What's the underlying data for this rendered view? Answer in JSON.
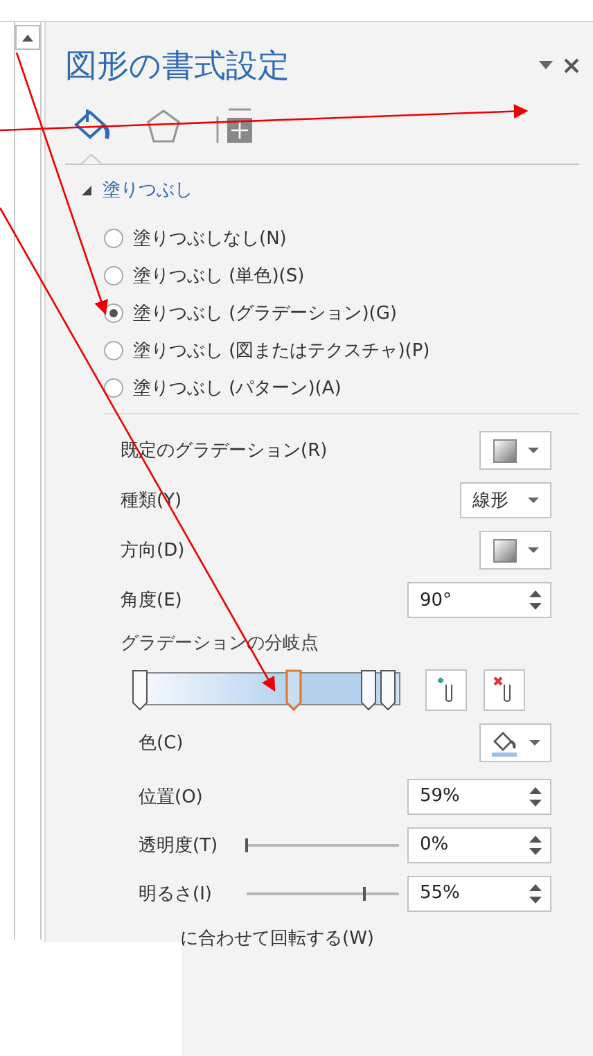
{
  "pane": {
    "title": "図形の書式設定"
  },
  "tabs": [
    {
      "kind": "fill",
      "selected": true
    },
    {
      "kind": "shape",
      "selected": false
    },
    {
      "kind": "layout",
      "selected": false
    }
  ],
  "section": {
    "title": "塗りつぶし",
    "expanded": true
  },
  "fill_options": [
    {
      "label": "塗りつぶしなし(N)",
      "selected": false
    },
    {
      "label": "塗りつぶし (単色)(S)",
      "selected": false
    },
    {
      "label": "塗りつぶし (グラデーション)(G)",
      "selected": true
    },
    {
      "label": "塗りつぶし (図またはテクスチャ)(P)",
      "selected": false
    },
    {
      "label": "塗りつぶし (パターン)(A)",
      "selected": false
    }
  ],
  "settings": [
    {
      "kind": "swatch",
      "label": "既定のグラデーション(R)"
    },
    {
      "kind": "dropdown",
      "label": "種類(Y)",
      "value": "線形"
    },
    {
      "kind": "swatch",
      "label": "方向(D)"
    },
    {
      "kind": "spin",
      "label": "角度(E)",
      "value": "90°"
    }
  ],
  "gradient_stops": {
    "label": "グラデーションの分岐点",
    "stops": [
      {
        "level": 0,
        "selected": false
      },
      {
        "level": 0.59,
        "selected": true
      },
      {
        "level": 0.88,
        "selected": false
      },
      {
        "level": 0.95,
        "selected": false
      }
    ]
  },
  "stop_settings": [
    {
      "kind": "color",
      "label": "色(C)"
    },
    {
      "kind": "spin",
      "label": "位置(O)",
      "value": "59%"
    },
    {
      "kind": "slider",
      "label": "透明度(T)",
      "level": 0,
      "value": "0%"
    },
    {
      "kind": "slider",
      "label": "明るさ(I)",
      "level": 0.775,
      "value": "55%"
    }
  ],
  "rotate_option": {
    "label": "に合わせて回転する(W)"
  }
}
